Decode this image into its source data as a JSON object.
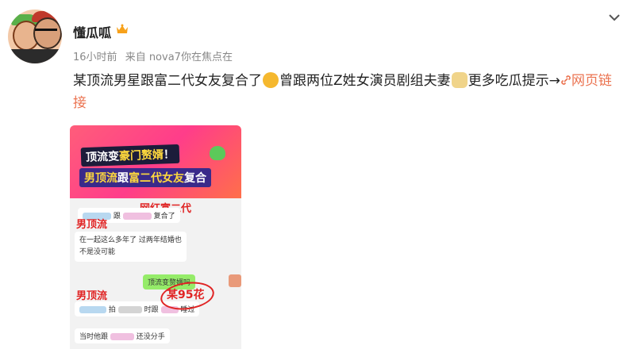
{
  "user": {
    "name": "懂瓜呱",
    "time": "16小时前",
    "source": "来自 nova7你在焦点在"
  },
  "post": {
    "text_a": "某顶流男星跟富二代女友复合了",
    "text_b": "曾跟两位Z姓女演员剧组夫妻",
    "text_c": "更多吃瓜提示→",
    "link_label": "网页链接"
  },
  "image": {
    "banner_line1_a": "顶流变",
    "banner_line1_b": "豪门赘婿",
    "banner_line1_c": "！",
    "banner_line2_a": "男顶流",
    "banner_line2_b": "跟",
    "banner_line2_c": "富二代女友",
    "banner_line2_d": "复合",
    "label_rich": "网红富二代",
    "label_top1": "男顶流",
    "label_top2": "男顶流",
    "chat1_mid": "跟",
    "chat1_end": "复合了",
    "chat2_line1": "在一起这么多年了 过两年结婚也",
    "chat2_line2": "不是没可能",
    "chat3": "顶流变赘婿吗",
    "chat4_a": "拍",
    "chat4_b": "时跟",
    "chat4_c": "睡过",
    "price": "某95花",
    "chat5_a": "当时他跟",
    "chat5_b": "还没分手"
  },
  "colors": {
    "link": "#eb7350",
    "banner_pink": "#ff3d8a",
    "label_red": "#e02424",
    "chat_green": "#95ec69"
  },
  "icons": [
    "vip-crown-icon",
    "chevron-down-icon",
    "smile-emoji-icon",
    "dog-emoji-icon",
    "link-icon",
    "frog-icon"
  ]
}
